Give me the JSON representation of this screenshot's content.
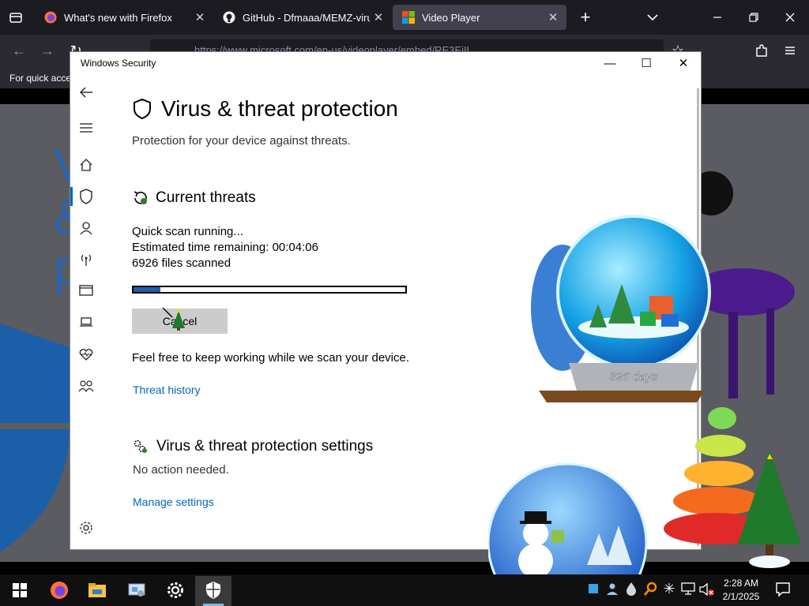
{
  "browser": {
    "tabs": [
      {
        "title": "What's new with Firefox",
        "icon": "firefox-icon"
      },
      {
        "title": "GitHub - Dfmaaa/MEMZ-virus:",
        "icon": "github-icon"
      },
      {
        "title": "Video Player",
        "icon": "windows-logo-icon"
      }
    ],
    "url": "https://www.microsoft.com/en-us/videoplayer/embed/RE3EiIL",
    "bookmarks_text": "For quick acce"
  },
  "security": {
    "window_title": "Windows Security",
    "page_title": "Virus & threat protection",
    "page_subtitle": "Protection for your device against threats.",
    "threats_heading": "Current threats",
    "scan_status": "Quick scan running...",
    "time_label": "Estimated time remaining:",
    "time_value": "00:04:06",
    "files_count": "6926",
    "files_label": "files scanned",
    "scan_progress": 0.1,
    "cancel_label": "Cancel",
    "keep_working": "Feel free to keep working while we scan your device.",
    "threat_history_link": "Threat history",
    "settings_heading": "Virus & threat protection settings",
    "settings_status": "No action needed.",
    "manage_settings_link": "Manage settings"
  },
  "overlay": {
    "globe_label": "326 days"
  },
  "taskbar": {
    "time": "2:28 AM",
    "date": "2/1/2025"
  },
  "colors": {
    "accent": "#0067c0",
    "link": "#0067b8",
    "progress": "#1b5fa8"
  }
}
